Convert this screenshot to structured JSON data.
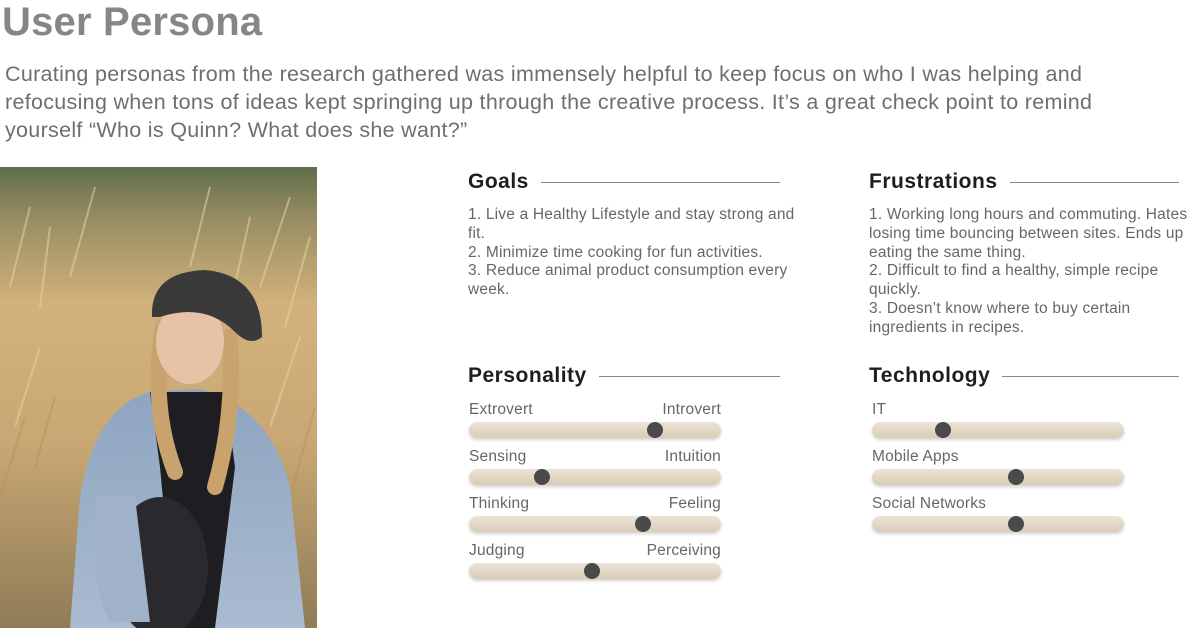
{
  "page": {
    "title": "User Persona",
    "intro": "Curating personas from the research gathered was immensely helpful to keep focus on who I was helping and refocusing when tons of ideas kept springing up through the creative process. It’s a great check point to remind yourself “Who is Quinn? What does she want?”"
  },
  "goals": {
    "heading": "Goals",
    "items": [
      "1. Live a Healthy Lifestyle and stay strong and fit.",
      "2. Minimize time cooking for fun activities.",
      "3. Reduce animal product consumption every week."
    ]
  },
  "frustrations": {
    "heading": "Frustrations",
    "items": [
      "1. Working long hours and commuting. Hates losing time bouncing between sites. Ends up eating the same thing.",
      "2. Difficult to find a  healthy, simple recipe quickly.",
      "3. Doesn’t know where to buy certain ingredients in recipes."
    ]
  },
  "personality": {
    "heading": "Personality",
    "scales": [
      {
        "left": "Extrovert",
        "right": "Introvert",
        "value": 0.74
      },
      {
        "left": "Sensing",
        "right": "Intuition",
        "value": 0.29
      },
      {
        "left": "Thinking",
        "right": "Feeling",
        "value": 0.69
      },
      {
        "left": "Judging",
        "right": "Perceiving",
        "value": 0.49
      }
    ]
  },
  "technology": {
    "heading": "Technology",
    "scales": [
      {
        "label": "IT",
        "value": 0.28
      },
      {
        "label": "Mobile Apps",
        "value": 0.57
      },
      {
        "label": "Social Networks",
        "value": 0.57
      }
    ]
  },
  "colors": {
    "track": "#e3d9c7",
    "knob": "#4a4a4a",
    "title": "#868686"
  }
}
